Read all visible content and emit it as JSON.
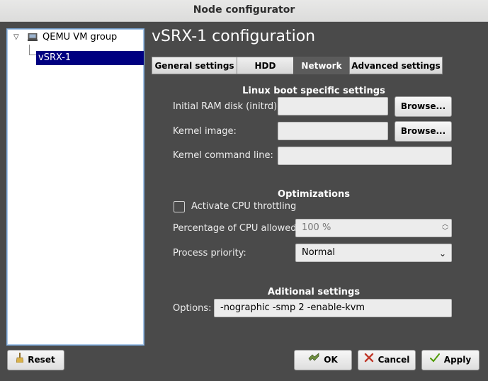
{
  "window": {
    "title": "Node configurator"
  },
  "tree": {
    "group_label": "QEMU VM group",
    "selected_item": "vSRX-1"
  },
  "heading": "vSRX-1 configuration",
  "tabs": [
    {
      "label": "General settings",
      "active": false
    },
    {
      "label": "HDD",
      "active": false
    },
    {
      "label": "Network",
      "active": true
    },
    {
      "label": "Advanced settings",
      "active": false
    }
  ],
  "linux_boot": {
    "title": "Linux boot specific settings",
    "initrd_label": "Initial RAM disk (initrd):",
    "initrd_value": "",
    "kernel_image_label": "Kernel image:",
    "kernel_image_value": "",
    "kernel_cmdline_label": "Kernel command line:",
    "kernel_cmdline_value": "",
    "browse_label": "Browse..."
  },
  "optimizations": {
    "title": "Optimizations",
    "cpu_throttling_label": "Activate CPU throttling",
    "cpu_throttling_checked": false,
    "cpu_percent_label": "Percentage of CPU allowed:",
    "cpu_percent_value": "100 %",
    "process_priority_label": "Process priority:",
    "process_priority_value": "Normal"
  },
  "additional": {
    "title": "Aditional settings",
    "options_label": "Options:",
    "options_value": "-nographic -smp 2 -enable-kvm"
  },
  "buttons": {
    "reset": "Reset",
    "ok": "OK",
    "cancel": "Cancel",
    "apply": "Apply"
  },
  "colors": {
    "background": "#4a4a4a",
    "selection": "#000080",
    "input_bg": "#ececec"
  }
}
